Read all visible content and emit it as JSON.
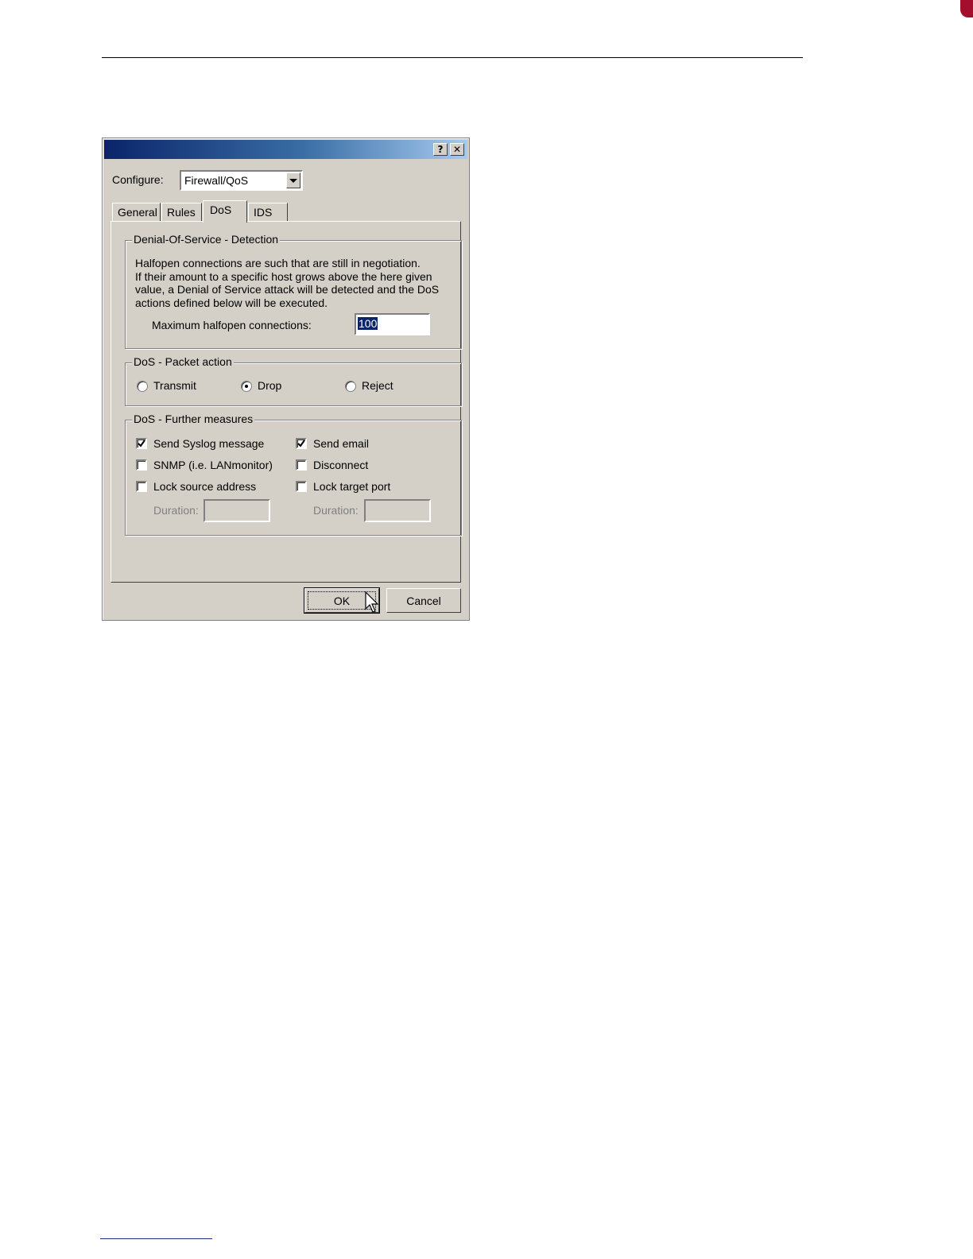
{
  "dialog": {
    "title_buttons": {
      "help": "?",
      "close": "✕"
    },
    "configure": {
      "label": "Configure:",
      "value": "Firewall/QoS"
    },
    "tabs": [
      {
        "label": "General",
        "active": false
      },
      {
        "label": "Rules",
        "active": false
      },
      {
        "label": "DoS",
        "active": true
      },
      {
        "label": "IDS",
        "active": false
      }
    ],
    "detection": {
      "title": "Denial-Of-Service - Detection",
      "description_lines": [
        "Halfopen connections are such that are still in negotiation.",
        "If their amount to a specific host grows above the here given",
        "value, a Denial of Service attack will be detected and the DoS",
        "actions defined below will be executed."
      ],
      "max_halfopen_label": "Maximum halfopen connections:",
      "max_halfopen_value": "100"
    },
    "packet_action": {
      "title": "DoS - Packet action",
      "options": [
        {
          "label": "Transmit",
          "selected": false
        },
        {
          "label": "Drop",
          "selected": true
        },
        {
          "label": "Reject",
          "selected": false
        }
      ]
    },
    "further_measures": {
      "title": "DoS - Further measures",
      "send_syslog": {
        "label": "Send Syslog message",
        "checked": true
      },
      "send_email": {
        "label": "Send email",
        "checked": true
      },
      "snmp": {
        "label": "SNMP (i.e. LANmonitor)",
        "checked": false
      },
      "disconnect": {
        "label": "Disconnect",
        "checked": false
      },
      "lock_source": {
        "label": "Lock source address",
        "checked": false
      },
      "lock_target": {
        "label": "Lock target port",
        "checked": false
      },
      "duration_label": "Duration:",
      "duration_source_value": "",
      "duration_target_value": ""
    },
    "buttons": {
      "ok": "OK",
      "cancel": "Cancel"
    }
  }
}
